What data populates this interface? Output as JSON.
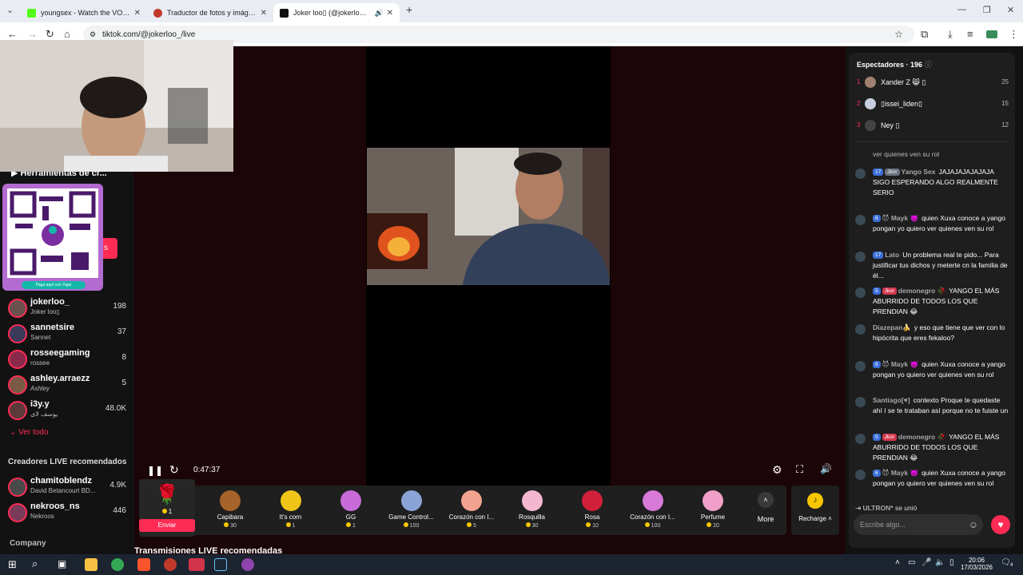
{
  "browser": {
    "tabs": [
      {
        "label": "youngsex - Watch the VOD on",
        "color": "#53fc18"
      },
      {
        "label": "Traductor de fotos y imágenes",
        "color": "#c0392b"
      },
      {
        "label": "Joker loo▯ (@jokerloo_) e",
        "color": "#111111"
      }
    ],
    "url": "tiktok.com/@jokerloo_/live"
  },
  "left": {
    "tools_label": "Herramientas de cr...",
    "qr_caption": "Paga aquí con Yape",
    "following": [
      {
        "name": "jokerloo_",
        "sub": "Joker loo▯",
        "count": "198"
      },
      {
        "name": "sannetsire",
        "sub": "Sannet",
        "count": "37"
      },
      {
        "name": "rosseegaming",
        "sub": "rossee",
        "count": "8"
      },
      {
        "name": "ashley.arraezz",
        "sub": "Ashley",
        "count": "5"
      },
      {
        "name": "i3y.y",
        "sub": "يوسف لاى",
        "count": "48.0K"
      }
    ],
    "see_all": "Ver todo",
    "recommended_title": "Creadores LIVE recomendados",
    "recommended": [
      {
        "name": "chamitoblendz",
        "sub": "David Betancourt BD...",
        "count": "4.9K"
      },
      {
        "name": "nekroos_ns",
        "sub": "Nekroos",
        "count": "446"
      }
    ],
    "company": "Company"
  },
  "player": {
    "time": "0:47:37",
    "bottom_heading": "Transmisiones LIVE recomendadas"
  },
  "gifts": [
    {
      "name": "Capibara",
      "price": "30",
      "color": "#a6642a"
    },
    {
      "name": "It's corn",
      "price": "1",
      "color": "#f0c419"
    },
    {
      "name": "GG",
      "price": "1",
      "color": "#c86bd8"
    },
    {
      "name": "Game Control...",
      "price": "100",
      "color": "#8aa4d8"
    },
    {
      "name": "Corazón con I...",
      "price": "5",
      "color": "#f2a38f"
    },
    {
      "name": "Rosquilla",
      "price": "30",
      "color": "#f5b6d0"
    },
    {
      "name": "Rosa",
      "price": "10",
      "color": "#d0203a"
    },
    {
      "name": "Corazón con I...",
      "price": "100",
      "color": "#d87ad8"
    },
    {
      "name": "Perfume",
      "price": "20",
      "color": "#f0a0c8"
    }
  ],
  "gift_selected": {
    "price": "1",
    "send": "Enviar"
  },
  "gift_more": "More",
  "recharge": "Recharge",
  "chat": {
    "viewers_label": "Espectadores · 196",
    "top_viewers": [
      {
        "rank": "1",
        "name": "Xander Z 😸 ▯",
        "score": "25"
      },
      {
        "rank": "2",
        "name": "▯issei_liden▯",
        "score": "15"
      },
      {
        "rank": "3",
        "name": "Ney ▯",
        "score": "12"
      }
    ],
    "partial_line": "ver quienes ven su rol",
    "messages": [
      {
        "badges": [
          [
            "17",
            "b-blue"
          ],
          [
            "Jkor",
            "b-gray"
          ]
        ],
        "user": "Yango Sex",
        "text": "JAJAJAJAJAJAJA SIGO ESPERANDO ALGO REALMENTE SERIO"
      },
      {
        "badges": [
          [
            "6",
            "b-blue"
          ]
        ],
        "user": "😈 Mayk 👿",
        "text": "quien Xuxa conoce a yango pongan yo quiero ver quienes ven su rol"
      },
      {
        "badges": [
          [
            "17",
            "b-blue"
          ]
        ],
        "user": "Lato",
        "text": "Un problema real te pido... Para justificar tus dichos y meterte cn la familia de él..."
      },
      {
        "badges": [
          [
            "5",
            "b-blue"
          ],
          [
            "Jkor",
            "b-red"
          ]
        ],
        "user": "demonegro 🥀",
        "text": "YANGO EL MÁS ABURRIDO DE TODOS LOS QUE PRENDIAN 😂"
      },
      {
        "badges": [],
        "user": "Diazepan🍌",
        "text": "y eso que tiene que ver con lo hipócrita que eres fekaloo?"
      },
      {
        "badges": [
          [
            "6",
            "b-blue"
          ]
        ],
        "user": "😈 Mayk 👿",
        "text": "quien Xuxa conoce a yango pongan yo quiero ver quienes ven su rol"
      },
      {
        "badges": [],
        "user": "Santiago[♥]",
        "text": "contexto Proque te quedaste ahí í se te trataban así porque no te fuiste un"
      },
      {
        "badges": [
          [
            "5",
            "b-blue"
          ],
          [
            "Jkor",
            "b-red"
          ]
        ],
        "user": "demonegro 🥀",
        "text": "YANGO EL MÁS ABURRIDO DE TODOS LOS QUE PRENDIAN 😂"
      },
      {
        "badges": [
          [
            "6",
            "b-blue"
          ]
        ],
        "user": "😈 Mayk 👿",
        "text": "quien Xuxa conoce a yango pongan yo quiero ver quienes ven su rol"
      }
    ],
    "join_user": "ULTRON*",
    "join_text": "se unió",
    "input_placeholder": "Escribe algo..."
  },
  "taskbar": {
    "time": "20:06",
    "date": "17/03/2026",
    "notif": "4"
  }
}
